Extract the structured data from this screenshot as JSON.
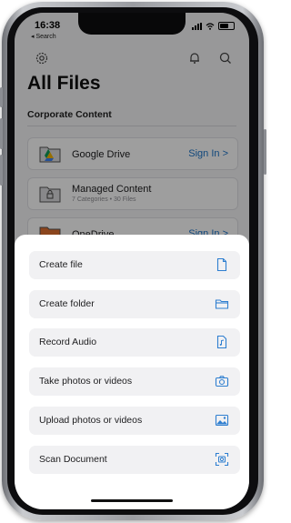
{
  "status_bar": {
    "time": "16:38",
    "back_label": "◂ Search"
  },
  "header": {
    "title": "All Files",
    "section": "Corporate Content"
  },
  "list": [
    {
      "label": "Google Drive",
      "action": "Sign In >"
    },
    {
      "label": "Managed Content",
      "subtitle": "7 Categories • 30 Files"
    },
    {
      "label": "OneDrive",
      "action": "Sign In >"
    }
  ],
  "sheet": {
    "actions": [
      {
        "label": "Create file",
        "icon": "file-icon"
      },
      {
        "label": "Create folder",
        "icon": "folder-icon"
      },
      {
        "label": "Record Audio",
        "icon": "audio-file-icon"
      },
      {
        "label": "Take photos or videos",
        "icon": "camera-icon"
      },
      {
        "label": "Upload photos or videos",
        "icon": "image-icon"
      },
      {
        "label": "Scan Document",
        "icon": "scan-icon"
      }
    ]
  },
  "colors": {
    "accent": "#1a73c8",
    "sheet_icon": "#2f7fd0"
  }
}
